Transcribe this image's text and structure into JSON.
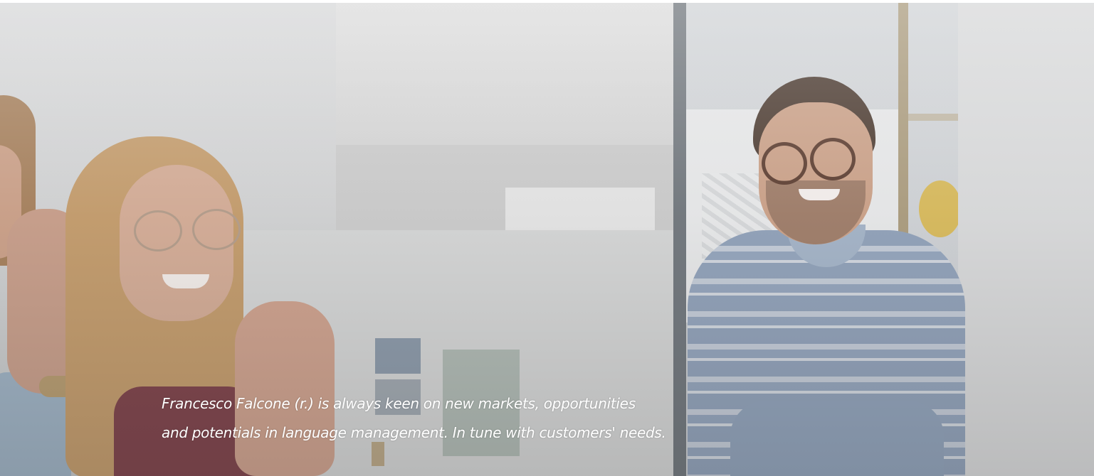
{
  "hero": {
    "caption_lines": [
      "Francesco Falcone (r.) is always keen on new markets, opportunities",
      "and potentials in language management. In tune with customers' needs."
    ]
  }
}
